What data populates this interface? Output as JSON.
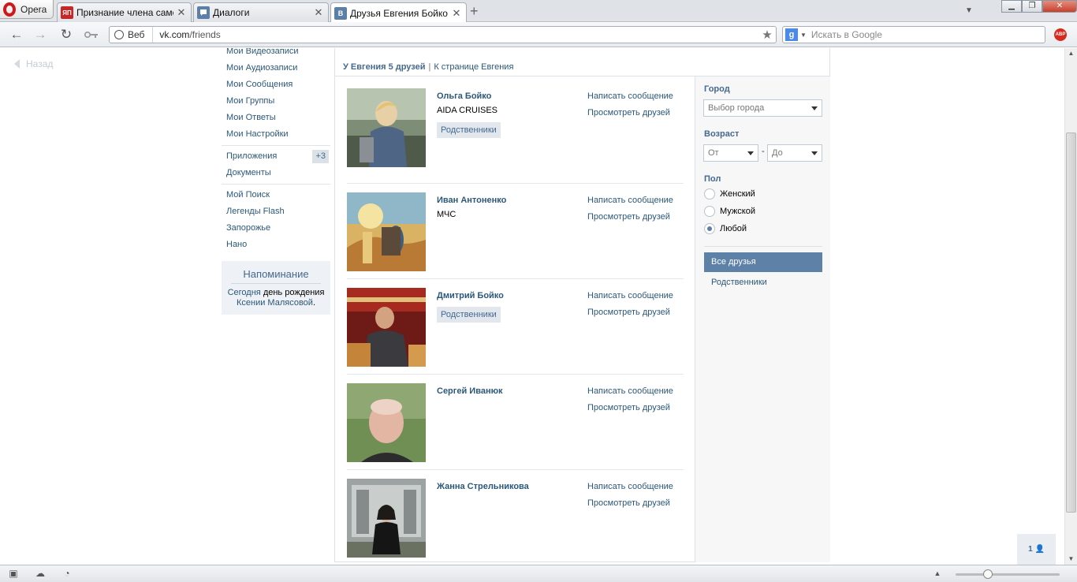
{
  "browser": {
    "menu_label": "Opera",
    "tabs": [
      {
        "title": "Признание члена самоо…",
        "favicon": "ЯП"
      },
      {
        "title": "Диалоги",
        "favicon": ""
      },
      {
        "title": "Друзья Евгения Бойко …",
        "favicon": "B"
      }
    ],
    "address": {
      "web_label": "Веб",
      "host": "vk.com",
      "path": "/friends"
    },
    "search_placeholder": "Искать в Google",
    "abp_label": "ABP"
  },
  "page": {
    "back_label": "Назад",
    "left_menu": [
      {
        "label": "Мои Видеозаписи"
      },
      {
        "label": "Мои Аудиозаписи"
      },
      {
        "label": "Мои Сообщения"
      },
      {
        "label": "Мои Группы"
      },
      {
        "label": "Мои Ответы"
      },
      {
        "label": "Мои Настройки"
      }
    ],
    "left_menu_2": [
      {
        "label": "Приложения",
        "badge": "+3"
      },
      {
        "label": "Документы"
      }
    ],
    "left_menu_3": [
      {
        "label": "Мой Поиск"
      },
      {
        "label": "Легенды Flash"
      },
      {
        "label": "Запорожье"
      },
      {
        "label": "Нано"
      }
    ],
    "reminder": {
      "title": "Напоминание",
      "today": "Сегодня",
      "text1": " день рождения ",
      "name": "Ксении Малясовой",
      "end": "."
    },
    "summary": {
      "count_text": "У Евгения 5 друзей",
      "separator": "|",
      "link": "К странице Евгения"
    },
    "friends": [
      {
        "name": "Ольга Бойко",
        "sub": "AIDA CRUISES",
        "tag": "Родственники",
        "msg": "Написать сообщение",
        "view": "Просмотреть друзей"
      },
      {
        "name": "Иван Антоненко",
        "sub": "МЧС",
        "tag": "",
        "msg": "Написать сообщение",
        "view": "Просмотреть друзей"
      },
      {
        "name": "Дмитрий Бойко",
        "sub": "",
        "tag": "Родственники",
        "msg": "Написать сообщение",
        "view": "Просмотреть друзей"
      },
      {
        "name": "Сергей Иванюк",
        "sub": "",
        "tag": "",
        "msg": "Написать сообщение",
        "view": "Просмотреть друзей"
      },
      {
        "name": "Жанна Стрельникова",
        "sub": "",
        "tag": "",
        "msg": "Написать сообщение",
        "view": "Просмотреть друзей"
      }
    ],
    "filters": {
      "city_label": "Город",
      "city_value": "Выбор города",
      "age_label": "Возраст",
      "age_from": "От",
      "age_dash": "-",
      "age_to": "До",
      "sex_label": "Пол",
      "sex_options": [
        "Женский",
        "Мужской",
        "Любой"
      ],
      "sex_selected": "Любой",
      "tabs": [
        "Все друзья",
        "Родственники"
      ],
      "tab_selected": "Все друзья"
    },
    "online_count": "1"
  }
}
